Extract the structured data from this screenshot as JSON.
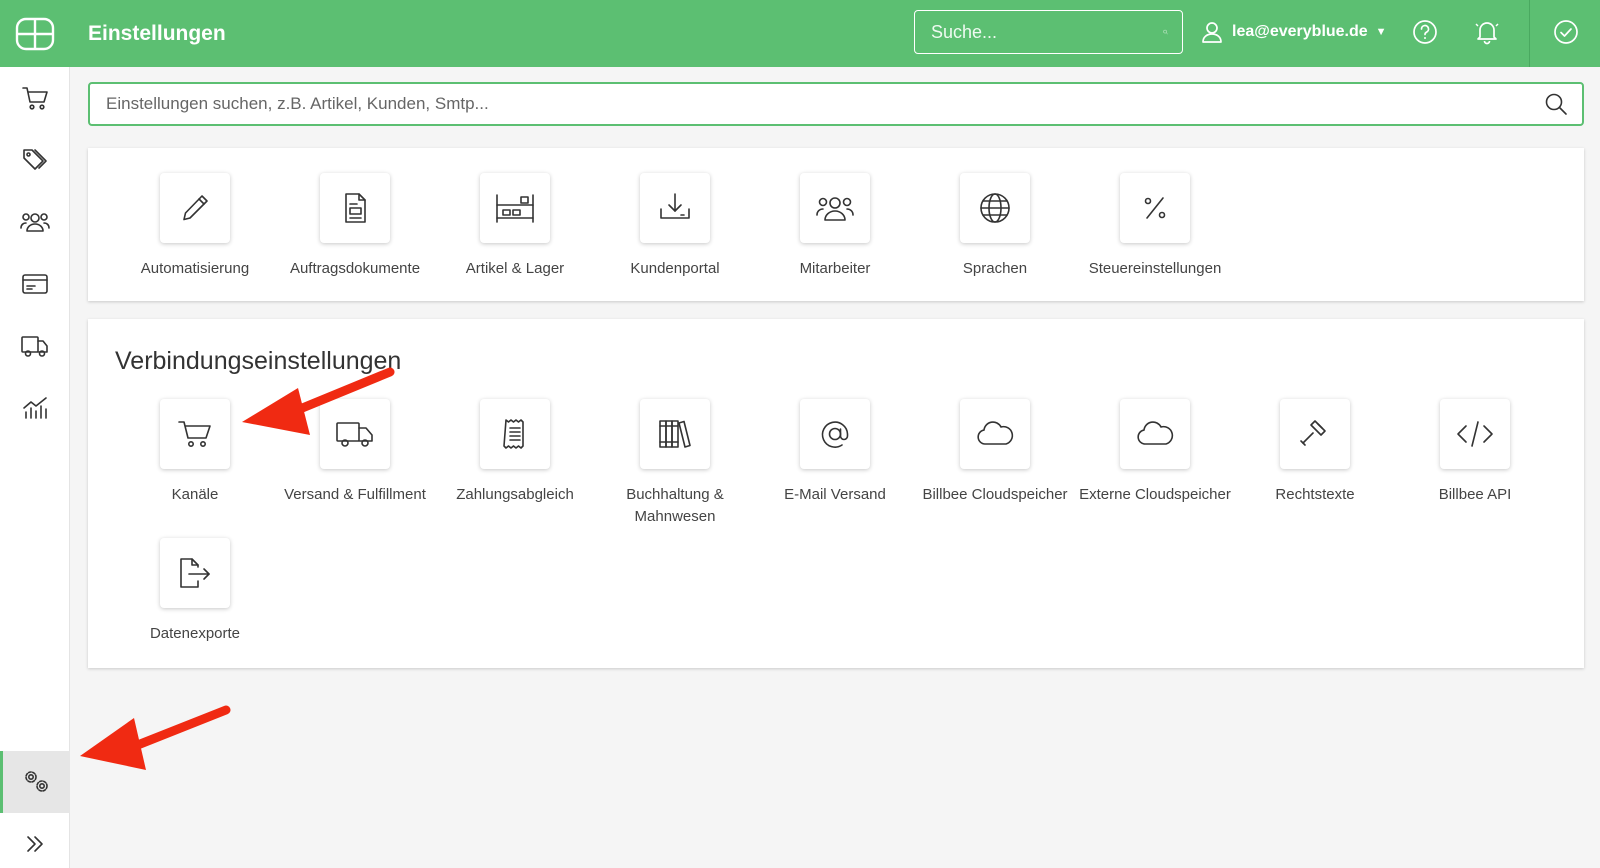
{
  "header": {
    "title": "Einstellungen",
    "search_placeholder": "Suche...",
    "user_email": "lea@everyblue.de",
    "accent_color": "#5cbf72"
  },
  "sidebar": {
    "items": [
      {
        "name": "orders",
        "icon": "cart-icon"
      },
      {
        "name": "articles",
        "icon": "tag-icon"
      },
      {
        "name": "customers",
        "icon": "users-icon"
      },
      {
        "name": "payments",
        "icon": "card-icon"
      },
      {
        "name": "shipping",
        "icon": "truck-icon"
      },
      {
        "name": "statistics",
        "icon": "chart-icon"
      },
      {
        "name": "settings",
        "icon": "gears-icon",
        "active": true
      },
      {
        "name": "expand",
        "icon": "double-chevron-icon"
      }
    ]
  },
  "settings_search": {
    "placeholder": "Einstellungen suchen, z.B. Artikel, Kunden, Smtp..."
  },
  "general_settings": {
    "tiles": [
      {
        "label": "Automatisierung",
        "icon": "pencil-icon"
      },
      {
        "label": "Auftragsdokumente",
        "icon": "document-icon"
      },
      {
        "label": "Artikel & Lager",
        "icon": "warehouse-icon"
      },
      {
        "label": "Kundenportal",
        "icon": "download-tray-icon"
      },
      {
        "label": "Mitarbeiter",
        "icon": "team-icon"
      },
      {
        "label": "Sprachen",
        "icon": "globe-icon"
      },
      {
        "label": "Steuereinstellungen",
        "icon": "percent-icon"
      }
    ]
  },
  "connection_settings": {
    "title": "Verbindungseinstellungen",
    "tiles": [
      {
        "label": "Kanäle",
        "icon": "cart-icon"
      },
      {
        "label": "Versand & Fulfillment",
        "icon": "truck-icon"
      },
      {
        "label": "Zahlungsabgleich",
        "icon": "receipt-icon"
      },
      {
        "label": "Buchhaltung & Mahnwesen",
        "icon": "books-icon"
      },
      {
        "label": "E-Mail Versand",
        "icon": "at-icon"
      },
      {
        "label": "Billbee Cloudspeicher",
        "icon": "cloud-icon"
      },
      {
        "label": "Externe Cloudspeicher",
        "icon": "cloud-icon"
      },
      {
        "label": "Rechtstexte",
        "icon": "gavel-icon"
      },
      {
        "label": "Billbee API",
        "icon": "code-icon"
      },
      {
        "label": "Datenexporte",
        "icon": "export-icon"
      }
    ]
  },
  "annotations": {
    "arrow_color": "#f02a12"
  }
}
